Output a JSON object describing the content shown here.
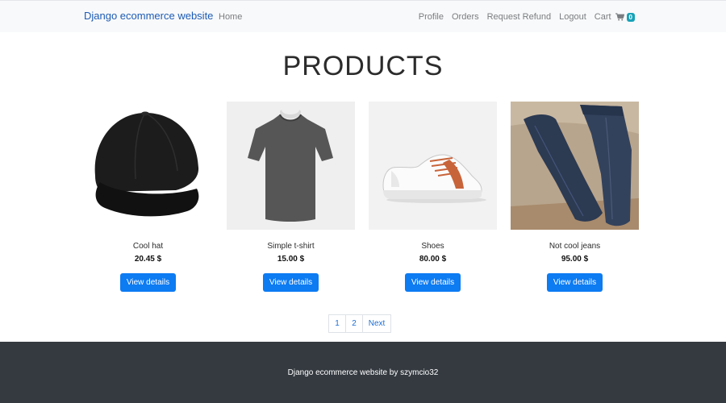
{
  "navbar": {
    "brand": "Django ecommerce website",
    "home": "Home",
    "links": [
      "Profile",
      "Orders",
      "Request Refund",
      "Logout"
    ],
    "cart_label": "Cart",
    "cart_icon": "shopping-cart-icon",
    "cart_count": "0"
  },
  "page": {
    "title": "PRODUCTS"
  },
  "products": [
    {
      "name": "Cool hat",
      "price": "20.45 $",
      "button": "View details",
      "image": "black-cap-image"
    },
    {
      "name": "Simple t-shirt",
      "price": "15.00 $",
      "button": "View details",
      "image": "grey-tshirt-image"
    },
    {
      "name": "Shoes",
      "price": "80.00 $",
      "button": "View details",
      "image": "white-sneaker-image"
    },
    {
      "name": "Not cool jeans",
      "price": "95.00 $",
      "button": "View details",
      "image": "blue-jeans-image"
    }
  ],
  "pagination": {
    "pages": [
      "1",
      "2"
    ],
    "next": "Next"
  },
  "footer": {
    "text": "Django ecommerce website by szymcio32"
  },
  "colors": {
    "primary": "#0d7bf2",
    "footer_bg": "#343a40",
    "navbar_bg": "#f8f9fa",
    "badge": "#17a2b8"
  }
}
